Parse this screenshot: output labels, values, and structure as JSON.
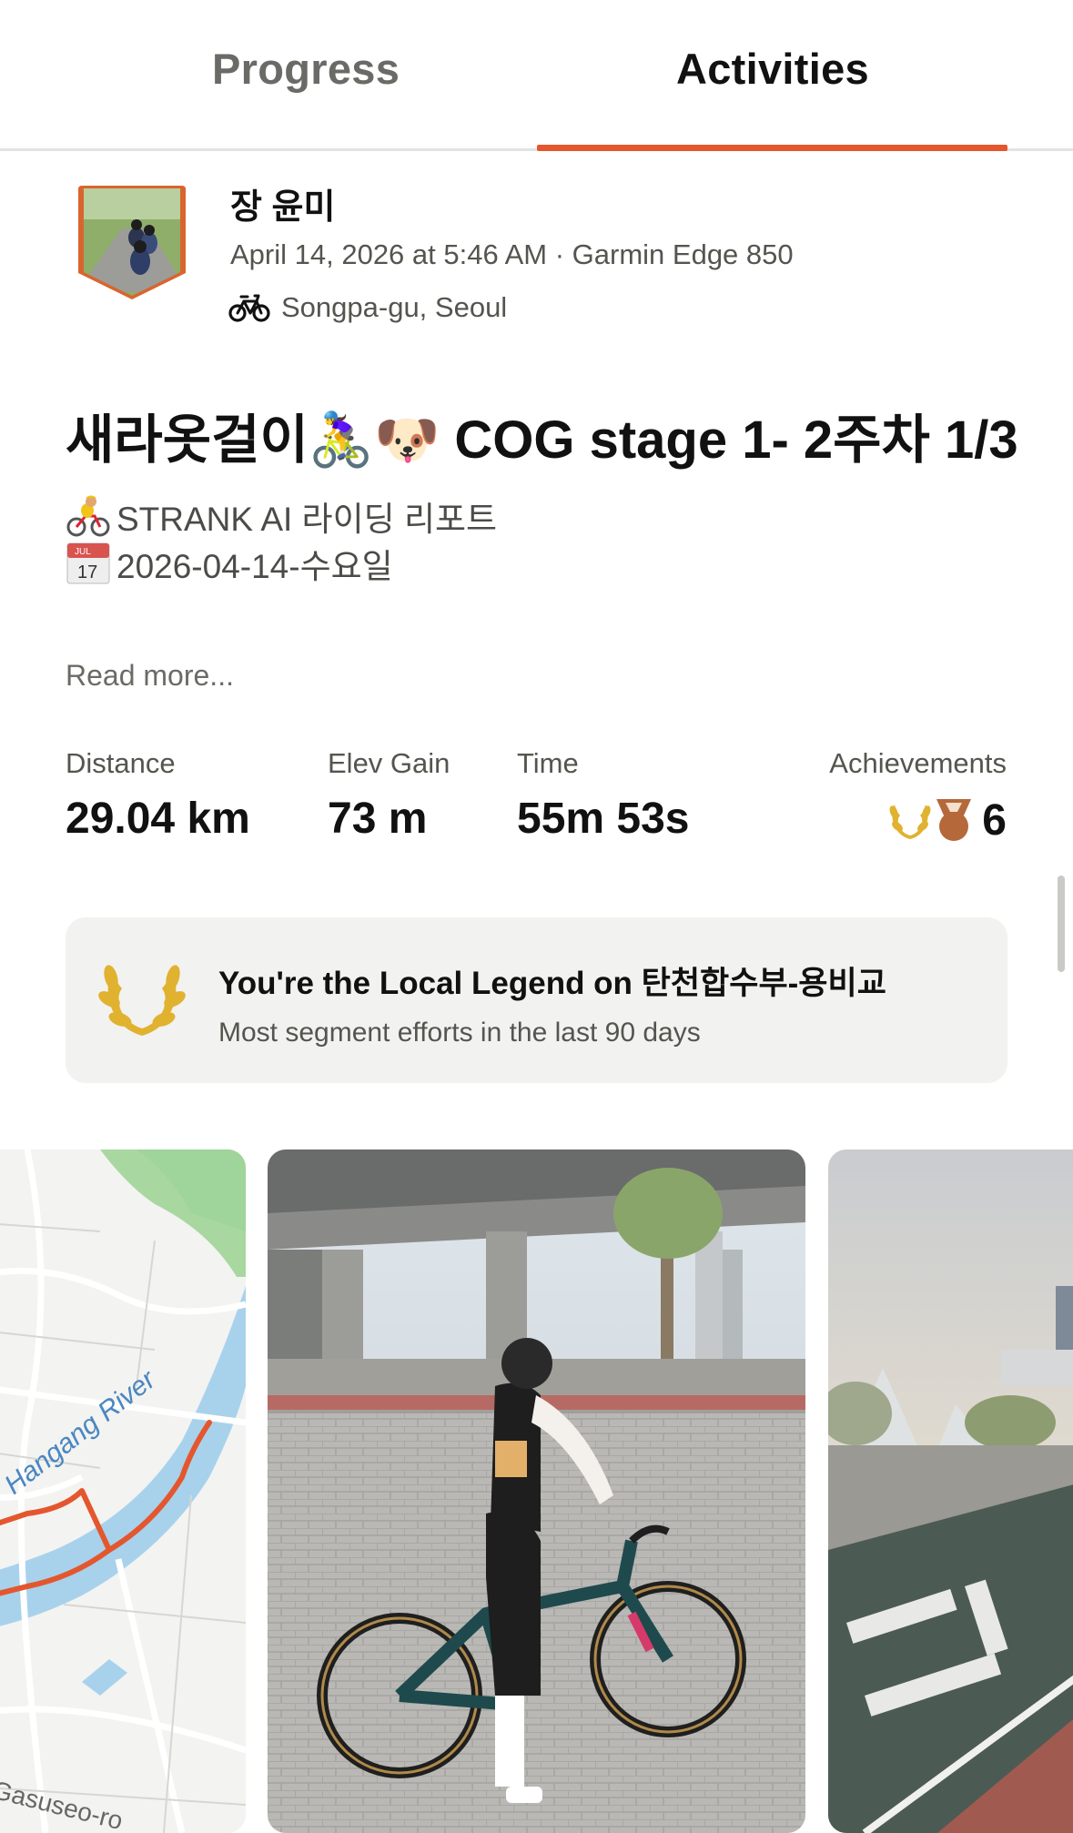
{
  "tabs": [
    {
      "label": "Progress",
      "active": false
    },
    {
      "label": "Activities",
      "active": true
    }
  ],
  "colors": {
    "accent": "#e4572e",
    "legend_gold": "#e0b22f",
    "bronze": "#b5683a"
  },
  "activity": {
    "athlete_name": "장 윤미",
    "meta": "April 14, 2026 at 5:46 AM · Garmin Edge 850",
    "sport_icon": "bike-icon",
    "location": "Songpa-gu, Seoul",
    "title": "새라옷걸이🚴‍♀️🐶 COG stage 1- 2주차 1/3",
    "description": [
      {
        "icon": "cyclist-emoji",
        "text": "STRANK AI 라이딩 리포트"
      },
      {
        "icon": "calendar-emoji",
        "text": "2026-04-14-수요일"
      }
    ],
    "read_more": "Read more..."
  },
  "stats": [
    {
      "label": "Distance",
      "value": "29.04 km"
    },
    {
      "label": "Elev Gain",
      "value": "73 m"
    },
    {
      "label": "Time",
      "value": "55m 53s"
    }
  ],
  "achievements": {
    "label": "Achievements",
    "count": "6",
    "icons": [
      "laurel-icon",
      "medal-icon"
    ]
  },
  "legend_card": {
    "title": "You're the Local Legend on 탄천합수부-용비교",
    "subtitle": "Most segment efforts in the last 90 days",
    "icon": "laurel-icon"
  },
  "media": {
    "map": {
      "river_label": "Hangang River",
      "road_label": "Gasuseo-ro"
    },
    "photos": [
      "cyclist-with-bike-photo",
      "riverside-park-photo"
    ]
  }
}
